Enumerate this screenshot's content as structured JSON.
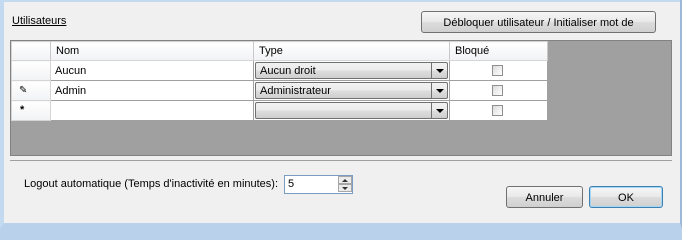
{
  "section": {
    "title": "Utilisateurs"
  },
  "toolbar": {
    "unlock_label": "Débloquer utilisateur / Initialiser mot de passe"
  },
  "grid": {
    "columns": [
      "Nom",
      "Type",
      "Bloqué"
    ],
    "rows": [
      {
        "indicator": "",
        "name": "Aucun",
        "type": "Aucun droit",
        "blocked": false
      },
      {
        "indicator": "pencil-icon",
        "name": "Admin",
        "type": "Administrateur",
        "blocked": false
      },
      {
        "indicator": "new-row-icon",
        "name": "",
        "type": "",
        "blocked": false
      }
    ]
  },
  "logout": {
    "label": "Logout automatique (Temps d'inactivité en minutes):",
    "value": "5"
  },
  "footer": {
    "cancel_label": "Annuler",
    "ok_label": "OK"
  }
}
